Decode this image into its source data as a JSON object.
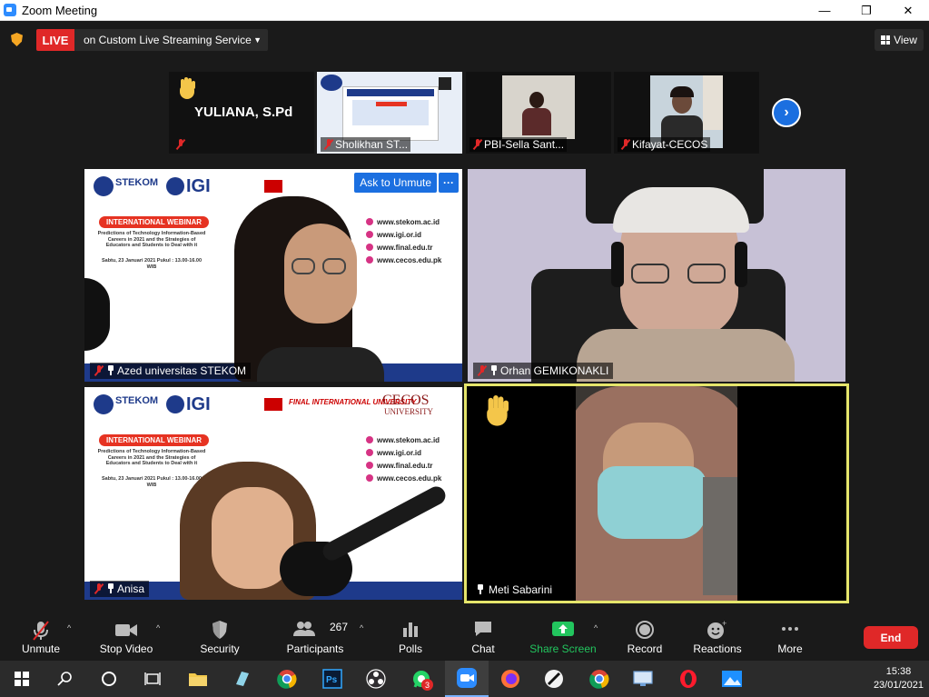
{
  "window": {
    "title": "Zoom Meeting",
    "min": "—",
    "restore": "❐",
    "close": "✕"
  },
  "live": {
    "badge": "LIVE",
    "service": "on Custom Live Streaming Service"
  },
  "view_button": "View",
  "strip": {
    "tiles": [
      {
        "name": "YULIANA, S.Pd"
      },
      {
        "name": "Sholikhan ST..."
      },
      {
        "name": "PBI-Sella Sant..."
      },
      {
        "name": "Kifayat-CECOS"
      }
    ]
  },
  "grid": {
    "tiles": [
      {
        "name": "Azed universitas STEKOM",
        "ask_to_unmute": "Ask to Unmute",
        "more": "···"
      },
      {
        "name": "Orhan GEMIKONAKLI"
      },
      {
        "name": "Anisa"
      },
      {
        "name": "Meti Sabarini"
      }
    ]
  },
  "slide": {
    "stekom": "STEKOM",
    "igi": "IGI",
    "final": "FINAL INTERNATIONAL UNIVERSITY",
    "cecos": "CECOS",
    "university": "UNIVERSITY",
    "webinar": "INTERNATIONAL WEBINAR",
    "desc": "Predictions of Technology Information-Based Careers in 2021 and the Strategies of Educators and Students to Deal with it",
    "date": "Sabtu, 23 Januari 2021 Pukul : 13.00-16.00 WIB",
    "urls": [
      "www.stekom.ac.id",
      "www.igi.or.id",
      "www.final.edu.tr",
      "www.cecos.edu.pk"
    ]
  },
  "toolbar": {
    "unmute": "Unmute",
    "stop_video": "Stop Video",
    "security": "Security",
    "participants": "Participants",
    "participant_count": "267",
    "polls": "Polls",
    "chat": "Chat",
    "share_screen": "Share Screen",
    "record": "Record",
    "reactions": "Reactions",
    "more": "More",
    "end": "End"
  },
  "taskbar": {
    "time": "15:38",
    "date": "23/01/2021",
    "whatsapp_badge": "3"
  },
  "colors": {
    "live": "#e02828",
    "share": "#22c55e",
    "active_speaker": "#e5e56b",
    "zoom_blue": "#1b6fe0"
  }
}
